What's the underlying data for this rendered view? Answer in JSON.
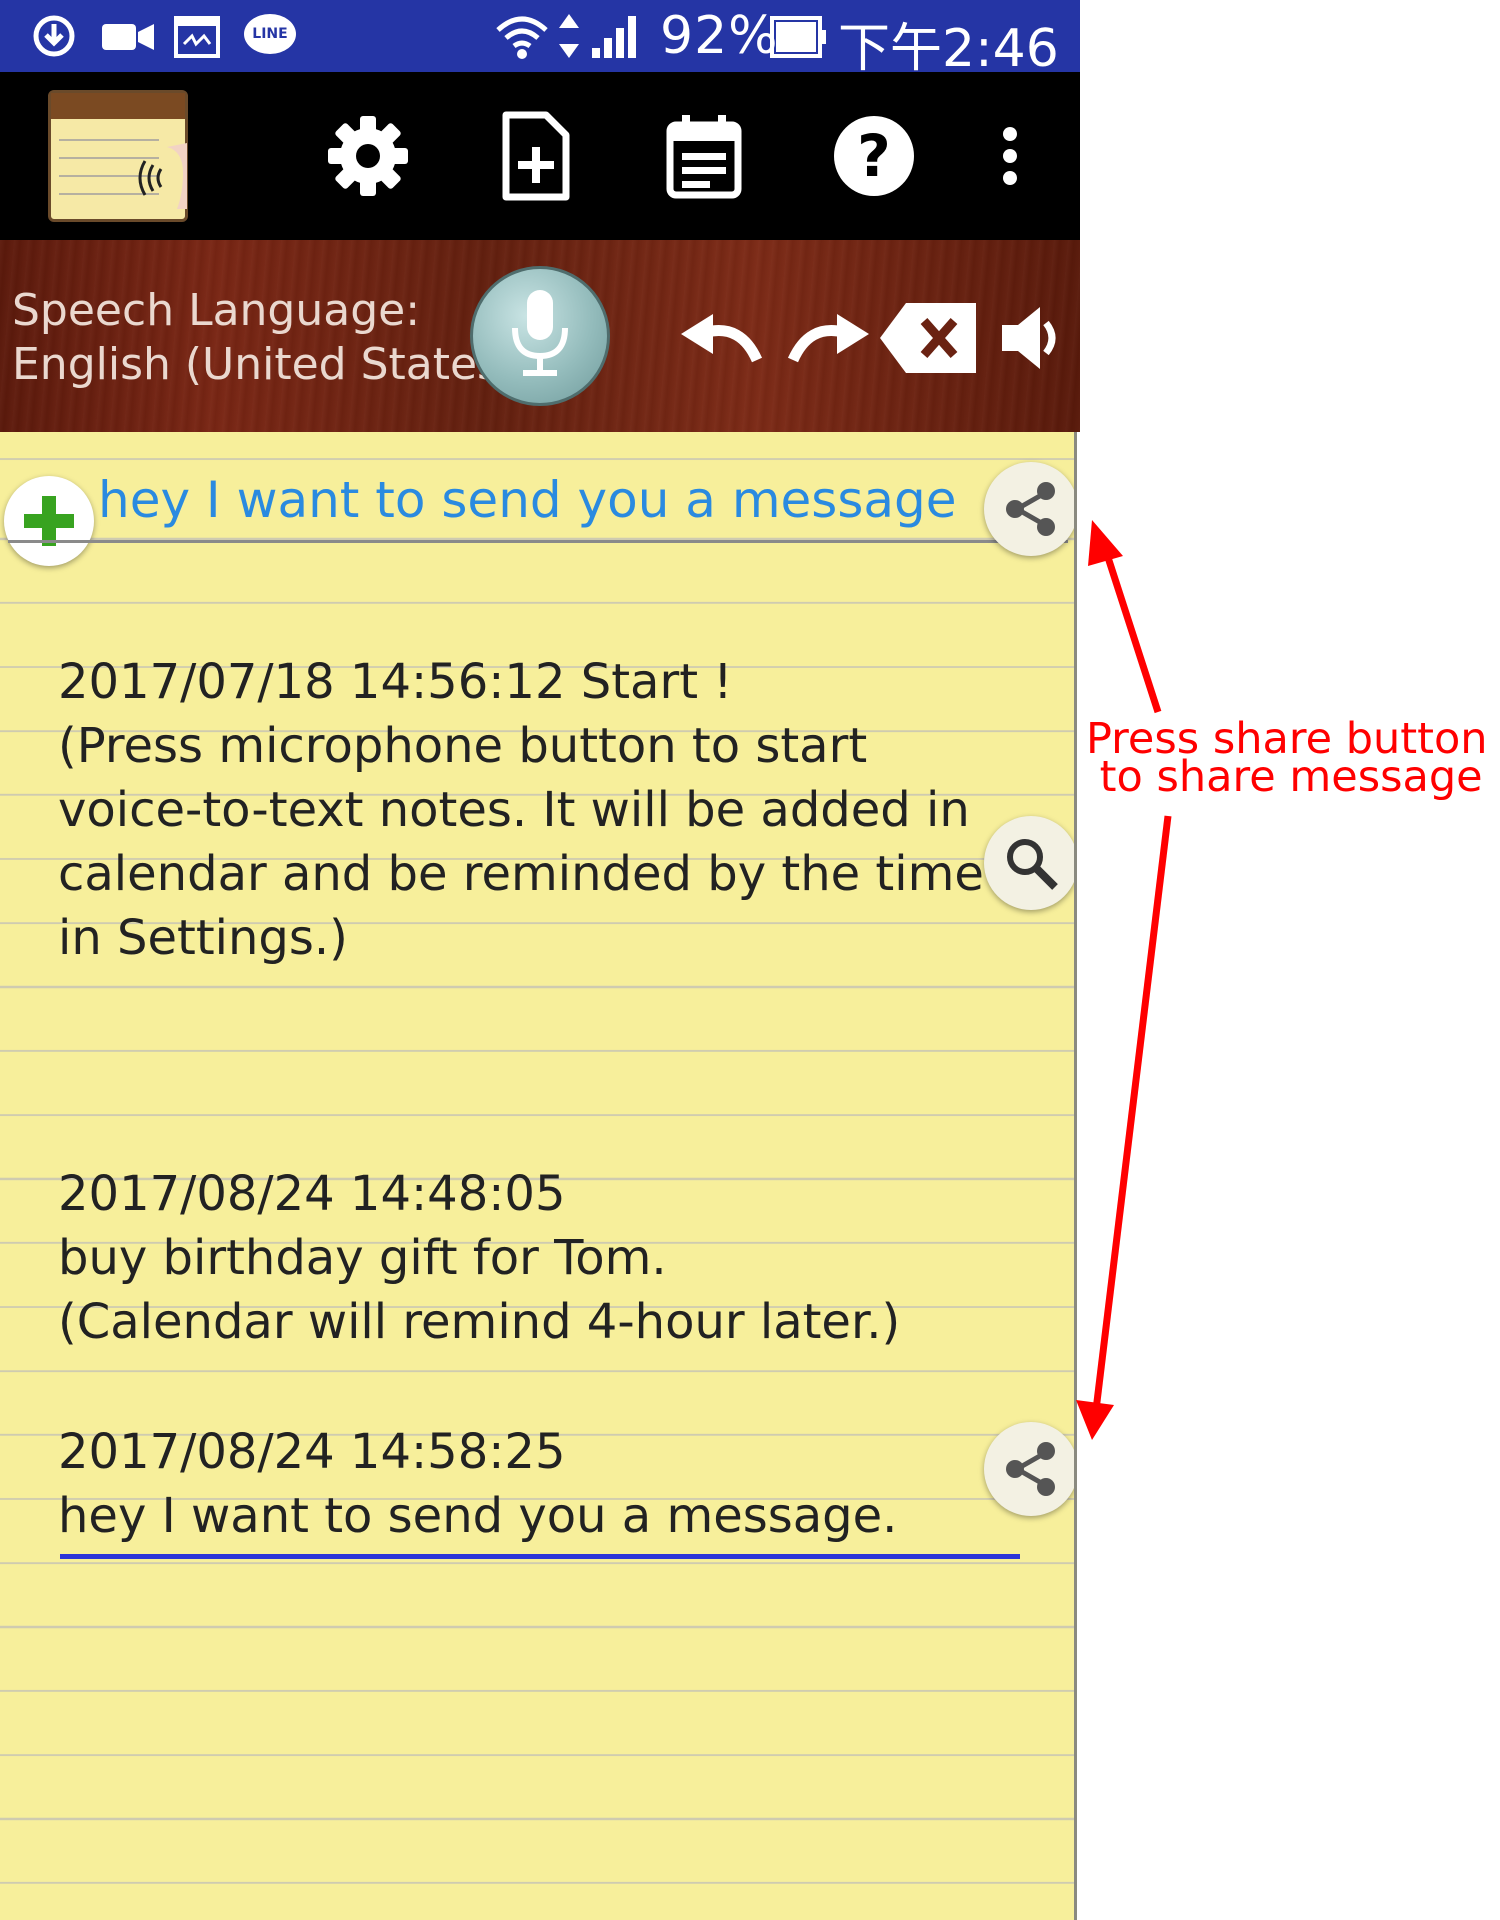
{
  "status_bar": {
    "line_badge": "LINE",
    "battery": "92%",
    "clock": "下午2:46"
  },
  "toolbar": {
    "icons": [
      "app-logo",
      "gear-icon",
      "new-document-icon",
      "calendar-icon",
      "help-icon",
      "more-vert-icon"
    ]
  },
  "speech": {
    "label": "Speech Language:\nEnglish (United States)",
    "icons": [
      "microphone-icon",
      "undo-icon",
      "redo-icon",
      "backspace-icon",
      "speaker-icon"
    ]
  },
  "editor": {
    "input_value": "hey I want to send you a message"
  },
  "notes": [
    {
      "text": "2017/07/18 14:56:12 Start !\n(Press microphone button to start\nvoice-to-text notes. It will be added in\ncalendar and be reminded by the time\nin Settings.)"
    },
    {
      "text": "2017/08/24 14:48:05\nbuy birthday gift for Tom.\n(Calendar will remind  4-hour later.)"
    },
    {
      "text": "2017/08/24 14:58:25\nhey I want to send you a message."
    }
  ],
  "annotation": {
    "text": "Press share button\n to share message",
    "color": "#ff0000"
  },
  "colors": {
    "status_bar": "#2535a5",
    "toolbar": "#000000",
    "speech_bar": "#6a2212",
    "paper": "#f7ef9b",
    "input_text": "#2a8ae0",
    "selected_underline": "#2c35d8"
  }
}
